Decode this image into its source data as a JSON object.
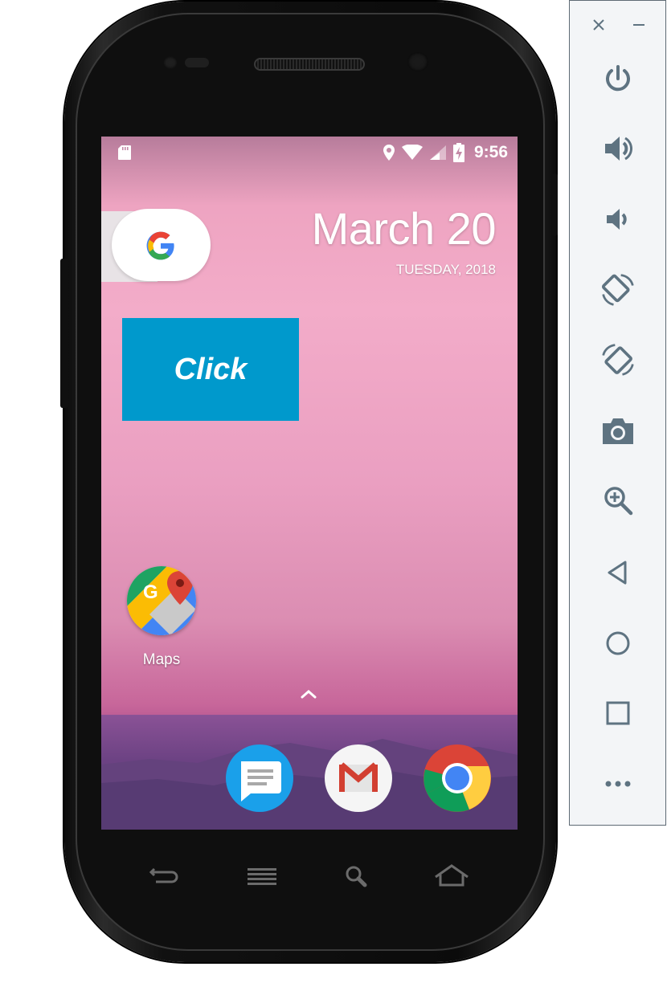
{
  "statusbar": {
    "time": "9:56",
    "icons": [
      "sd-card-icon",
      "location-icon",
      "wifi-icon",
      "signal-icon",
      "battery-charging-icon"
    ]
  },
  "home": {
    "search_widget_icon": "google-g-icon",
    "date_main": "March 20",
    "date_sub": "TUESDAY, 2018",
    "click_button_label": "Click",
    "apps": [
      {
        "label": "Maps",
        "icon": "google-maps-icon"
      }
    ],
    "dock_apps": [
      {
        "icon": "messages-icon"
      },
      {
        "icon": "gmail-icon"
      },
      {
        "icon": "chrome-icon"
      }
    ],
    "app_drawer_icon": "chevron-up-icon"
  },
  "hardware_keys": [
    "back-icon",
    "menu-icon",
    "search-icon",
    "home-icon"
  ],
  "emulator_toolbar": {
    "window_controls": [
      "close-icon",
      "minimize-icon"
    ],
    "buttons": [
      "power-icon",
      "volume-up-icon",
      "volume-down-icon",
      "rotate-left-icon",
      "rotate-right-icon",
      "camera-icon",
      "zoom-icon",
      "back-triangle-icon",
      "home-circle-icon",
      "overview-square-icon",
      "more-icon"
    ]
  },
  "colors": {
    "click_button": "#0099cc",
    "toolbar_icon": "#5e7381",
    "toolbar_bg": "#f3f5f7"
  }
}
